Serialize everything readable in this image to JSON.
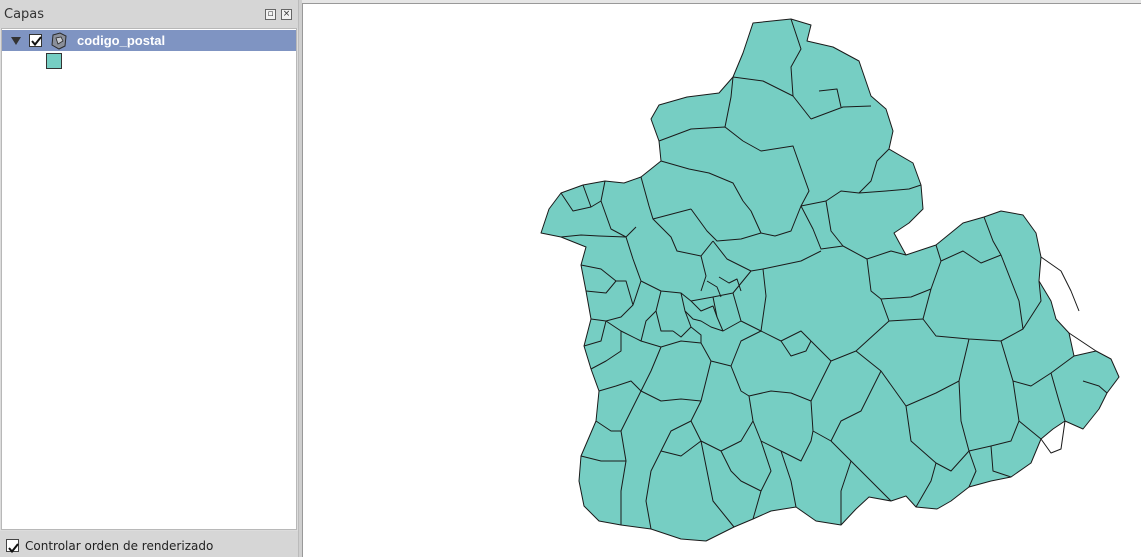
{
  "layers_panel": {
    "title": "Capas",
    "layers": [
      {
        "name": "codigo_postal",
        "checked": true,
        "expanded": true,
        "fill_color": "#76cec3"
      }
    ],
    "footer": {
      "label": "Controlar orden de renderizado",
      "checked": true
    }
  },
  "map": {
    "layer_fill": "#76cec3",
    "border_color": "#1a1a1a",
    "background": "#ffffff"
  }
}
